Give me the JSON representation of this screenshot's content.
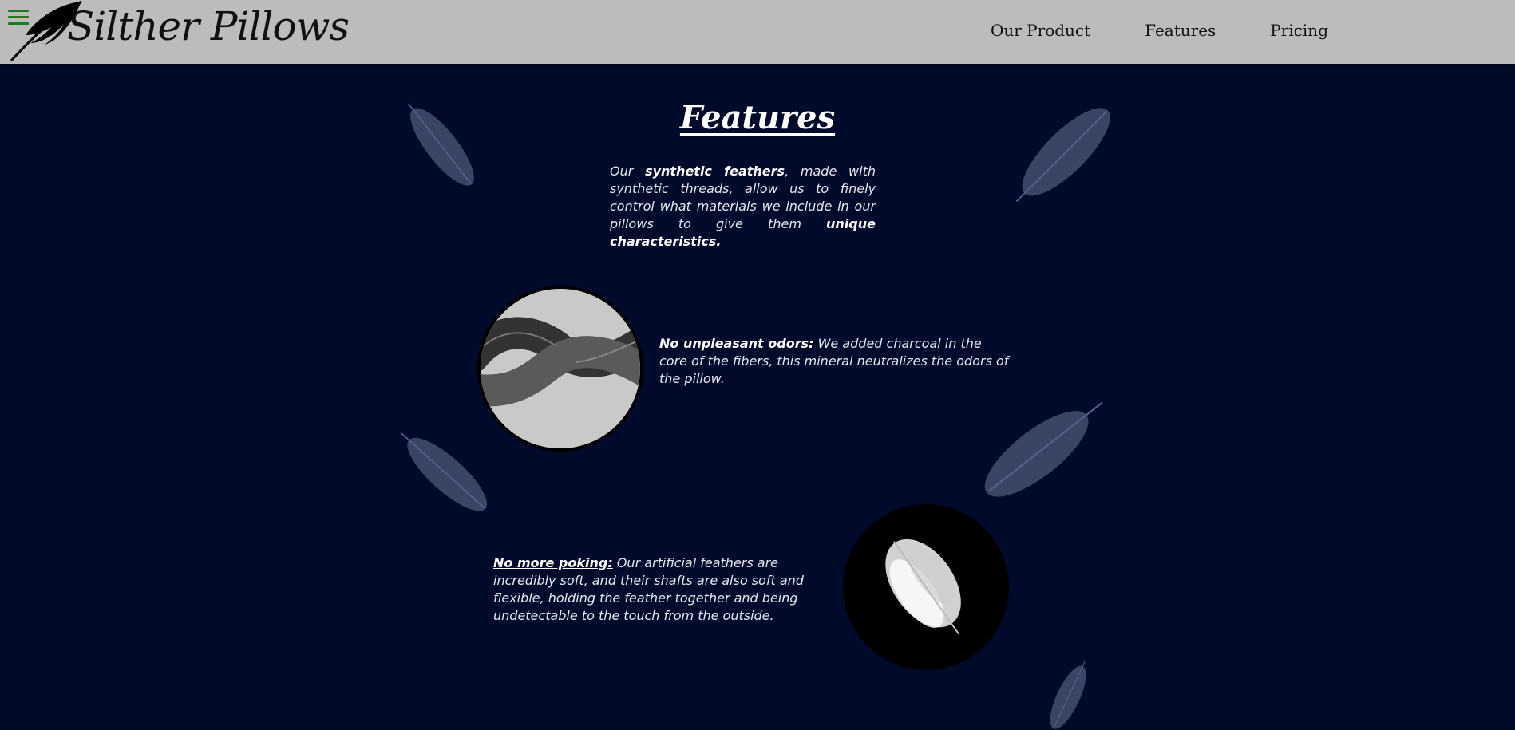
{
  "header": {
    "brand": "Silther Pillows",
    "nav": [
      "Our Product",
      "Features",
      "Pricing"
    ]
  },
  "features": {
    "title": "Features",
    "intro": {
      "p1": "Our ",
      "b1": "synthetic feathers",
      "p2": ", made with synthetic threads, allow us to finely control what materials we include in our pillows to give them ",
      "b2": "unique characteristics."
    },
    "items": [
      {
        "label": "No unpleasant odors:",
        "text": " We added charcoal in the core of the fibers, this mineral neutralizes the odors of the pillow."
      },
      {
        "label": "No more poking:",
        "text": " Our artificial feathers are incredibly soft, and their shafts are also soft and flexible, holding the feather together and being undetectable to the touch from the outside."
      }
    ]
  },
  "colors": {
    "background": "#000a2a",
    "header": "#bcbcbc",
    "feather": "#3a4566",
    "menu_icon": "#1f7a1f"
  },
  "icons": [
    "menu-icon",
    "feather-logo-icon"
  ]
}
